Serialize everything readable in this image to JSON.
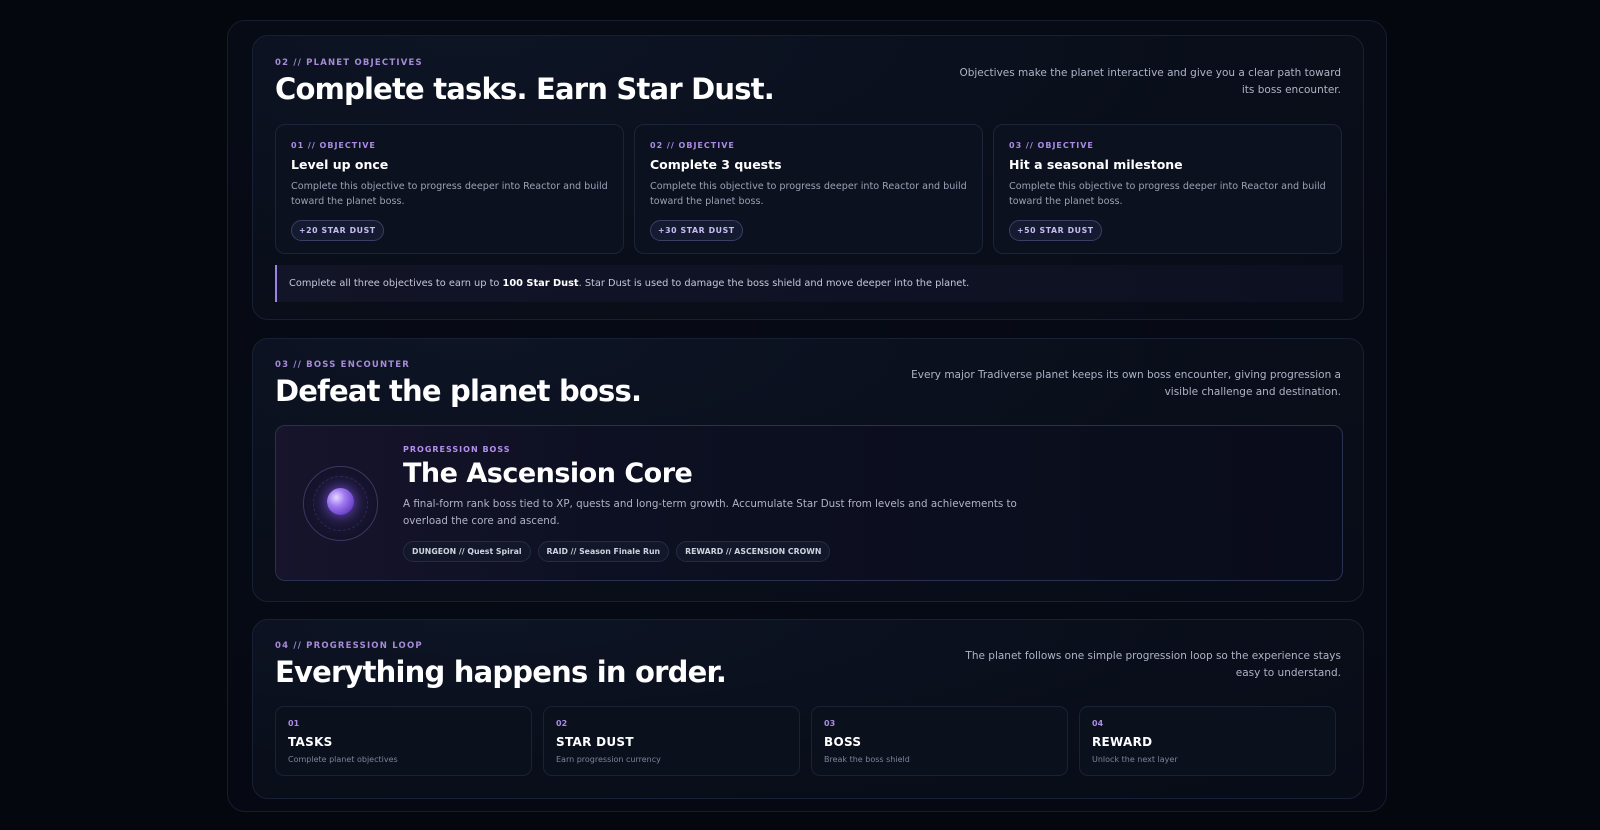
{
  "objectives": {
    "eyebrow": "02 // PLANET OBJECTIVES",
    "title": "Complete tasks. Earn Star Dust.",
    "intro": "Objectives make the planet interactive and give you a clear path toward its boss encounter.",
    "cards": [
      {
        "eyebrow": "01 // OBJECTIVE",
        "title": "Level up once",
        "desc": "Complete this objective to progress deeper into Reactor and build toward the planet boss.",
        "reward": "+20 STAR DUST"
      },
      {
        "eyebrow": "02 // OBJECTIVE",
        "title": "Complete 3 quests",
        "desc": "Complete this objective to progress deeper into Reactor and build toward the planet boss.",
        "reward": "+30 STAR DUST"
      },
      {
        "eyebrow": "03 // OBJECTIVE",
        "title": "Hit a seasonal milestone",
        "desc": "Complete this objective to progress deeper into Reactor and build toward the planet boss.",
        "reward": "+50 STAR DUST"
      }
    ],
    "note_prefix": "Complete all three objectives to earn up to ",
    "note_bold": "100 Star Dust",
    "note_suffix": ". Star Dust is used to damage the boss shield and move deeper into the planet."
  },
  "boss": {
    "eyebrow": "03 // BOSS ENCOUNTER",
    "title": "Defeat the planet boss.",
    "intro": "Every major Tradiverse planet keeps its own boss encounter, giving progression a visible challenge and destination.",
    "card": {
      "eyebrow": "PROGRESSION BOSS",
      "title": "The Ascension Core",
      "desc": "A final-form rank boss tied to XP, quests and long-term growth. Accumulate Star Dust from levels and achievements to overload the core and ascend.",
      "tags": [
        "DUNGEON // Quest Spiral",
        "RAID // Season Finale Run",
        "REWARD // ASCENSION CROWN"
      ]
    }
  },
  "loop": {
    "eyebrow": "04 // PROGRESSION LOOP",
    "title": "Everything happens in order.",
    "intro": "The planet follows one simple progression loop so the experience stays easy to understand.",
    "steps": [
      {
        "num": "01",
        "title": "TASKS",
        "desc": "Complete planet objectives"
      },
      {
        "num": "02",
        "title": "STAR DUST",
        "desc": "Earn progression currency"
      },
      {
        "num": "03",
        "title": "BOSS",
        "desc": "Break the boss shield"
      },
      {
        "num": "04",
        "title": "REWARD",
        "desc": "Unlock the next layer"
      }
    ]
  },
  "colors": {
    "accent": "#a98be4",
    "background": "#05070f",
    "panel": "#090e1a"
  }
}
